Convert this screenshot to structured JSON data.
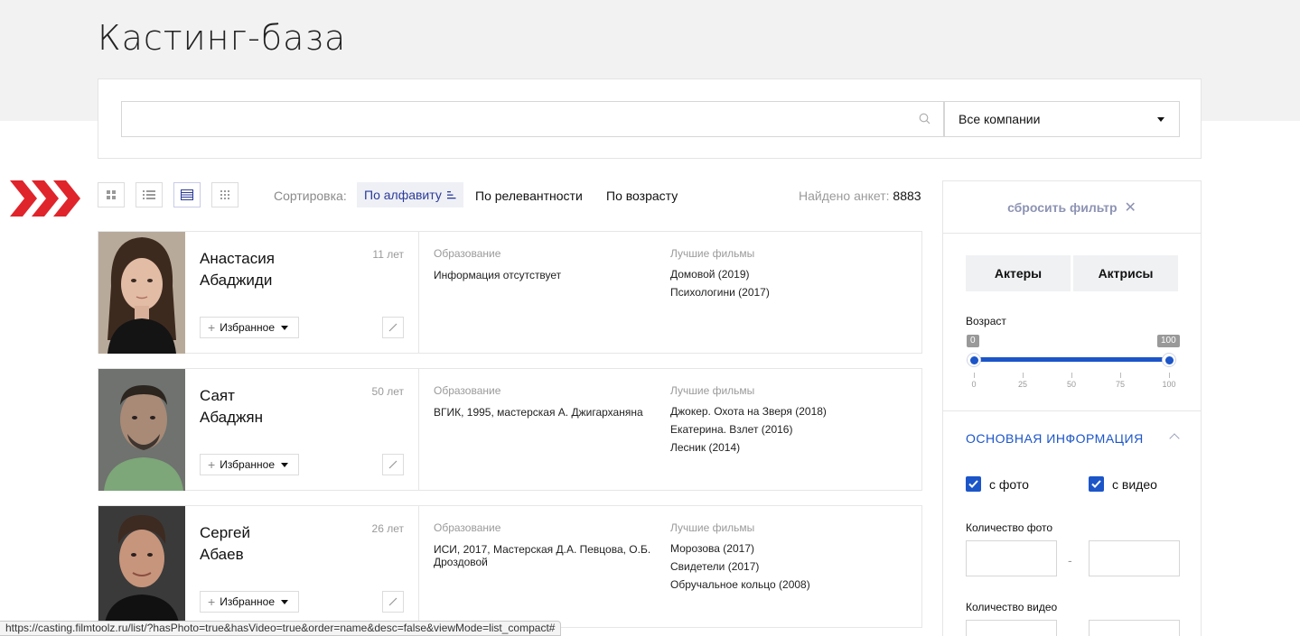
{
  "page": {
    "title": "Кастинг-база"
  },
  "search": {
    "value": "",
    "placeholder": "",
    "company_select": "Все компании"
  },
  "toolbar": {
    "sort_label": "Сортировка:",
    "sort_options": [
      "По алфавиту",
      "По релевантности",
      "По возрасту"
    ],
    "found_label": "Найдено анкет:",
    "found_count": "8883"
  },
  "cards": [
    {
      "first_name": "Анастасия",
      "last_name": "Абаджиди",
      "age": "11 лет",
      "fav_label": "Избранное",
      "edu_head": "Образование",
      "edu": "Информация отсутствует",
      "films_head": "Лучшие фильмы",
      "films": [
        "Домовой (2019)",
        "Психологини (2017)"
      ]
    },
    {
      "first_name": "Саят",
      "last_name": "Абаджян",
      "age": "50 лет",
      "fav_label": "Избранное",
      "edu_head": "Образование",
      "edu": "ВГИК, 1995, мастерская А. Джигарханяна",
      "films_head": "Лучшие фильмы",
      "films": [
        "Джокер. Охота на Зверя (2018)",
        "Екатерина. Взлет (2016)",
        "Лесник (2014)"
      ]
    },
    {
      "first_name": "Сергей",
      "last_name": "Абаев",
      "age": "26 лет",
      "fav_label": "Избранное",
      "edu_head": "Образование",
      "edu": "ИСИ, 2017, Мастерская Д.А. Певцова, О.Б. Дроздовой",
      "films_head": "Лучшие фильмы",
      "films": [
        "Морозова (2017)",
        "Свидетели (2017)",
        "Обручальное кольцо (2008)"
      ]
    }
  ],
  "filter": {
    "reset_label": "сбросить фильтр",
    "gender": [
      "Актеры",
      "Актрисы"
    ],
    "age_label": "Возраст",
    "age_min": "0",
    "age_max": "100",
    "age_ticks": [
      "0",
      "25",
      "50",
      "75",
      "100"
    ],
    "section_title": "ОСНОВНАЯ ИНФОРМАЦИЯ",
    "with_photo": "с фото",
    "with_video": "с видео",
    "photo_count_label": "Количество фото",
    "video_count_label": "Количество видео",
    "range_dash": "-"
  },
  "statusbar": {
    "url": "https://casting.filmtoolz.ru/list/?hasPhoto=true&hasVideo=true&order=name&desc=false&viewMode=list_compact#"
  },
  "colors": {
    "accent": "#1c55c8",
    "arrow": "#e0242b",
    "band": "#f2f2f2"
  }
}
